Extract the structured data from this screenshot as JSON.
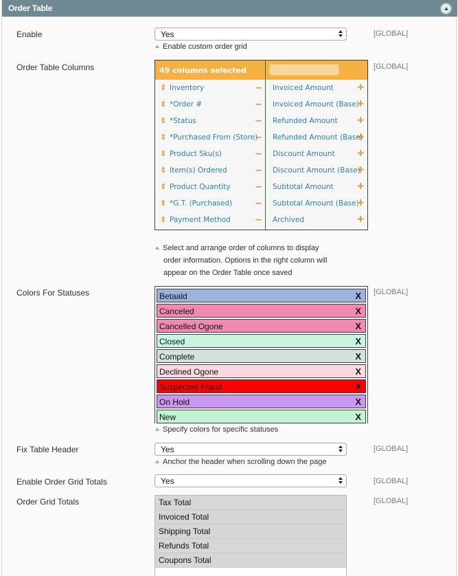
{
  "header": {
    "title": "Order Table",
    "collapse_icon": "collapse-up-icon"
  },
  "fields": {
    "enable": {
      "label": "Enable",
      "value": "Yes",
      "note": "Enable custom order grid",
      "scope": "[GLOBAL]"
    },
    "columns": {
      "label": "Order Table Columns",
      "scope": "[GLOBAL]",
      "count_text": "49 columns selected",
      "search_placeholder": "",
      "selected": [
        "Inventory",
        "*Order #",
        "*Status",
        "*Purchased From (Store)",
        "Product Sku(s)",
        "Item(s) Ordered",
        "Product Quantity",
        "*G.T. (Purchased)",
        "Payment Method"
      ],
      "available": [
        "Invoiced Amount",
        "Invoiced Amount (Base)",
        "Refunded Amount",
        "Refunded Amount (Base)",
        "Discount Amount",
        "Discount Amount (Base)",
        "Subtotal Amount",
        "Subtotal Amount (Base)",
        "Archived"
      ],
      "remove_symbol": "−",
      "add_symbol": "+",
      "drag_symbol": "⇕",
      "note_lines": [
        "Select and arrange order of columns to display",
        "order information. Options in the right column will",
        "appear on the Order Table once saved"
      ]
    },
    "statuses": {
      "label": "Colors For Statuses",
      "scope": "[GLOBAL]",
      "remove_symbol": "X",
      "items": [
        {
          "name": "Betaald",
          "color": "#9eb2e0"
        },
        {
          "name": "Canceled",
          "color": "#f08ab2"
        },
        {
          "name": "Cancelled Ogone",
          "color": "#f08ab2"
        },
        {
          "name": "Closed",
          "color": "#c8f4e2"
        },
        {
          "name": "Complete",
          "color": "#d4e2dc"
        },
        {
          "name": "Declined Ogone",
          "color": "#fcd8e2"
        },
        {
          "name": "Suspected Fraud",
          "color": "#ff0000"
        },
        {
          "name": "On Hold",
          "color": "#c996f0"
        },
        {
          "name": "New",
          "color": "#c2f4d2"
        }
      ],
      "note": "Specify colors for specific statuses"
    },
    "fix_header": {
      "label": "Fix Table Header",
      "value": "Yes",
      "note": "Anchor the header when scrolling down the page",
      "scope": "[GLOBAL]"
    },
    "grid_totals_enable": {
      "label": "Enable Order Grid Totals",
      "value": "Yes",
      "scope": "[GLOBAL]"
    },
    "grid_totals": {
      "label": "Order Grid Totals",
      "scope": "[GLOBAL]",
      "options": [
        "Tax Total",
        "Invoiced Total",
        "Shipping Total",
        "Refunds Total",
        "Coupons Total"
      ]
    }
  }
}
